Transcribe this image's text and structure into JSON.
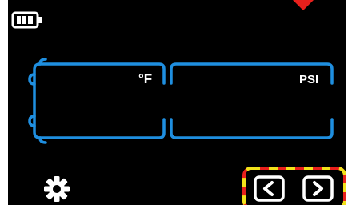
{
  "status_bar": {
    "battery_icon": "battery-icon"
  },
  "panels": {
    "temperature": {
      "unit": "°F"
    },
    "pressure": {
      "unit": "PSI"
    }
  },
  "controls": {
    "settings_icon": "gear-icon",
    "prev_icon": "chevron-left-icon",
    "next_icon": "chevron-right-icon"
  },
  "colors": {
    "screen_bg": "#000000",
    "panel_outline": "#1f8fe0",
    "text": "#ffffff",
    "highlight_red": "#e8201c",
    "highlight_yellow": "#f2e21a",
    "marker": "#e8201c"
  }
}
